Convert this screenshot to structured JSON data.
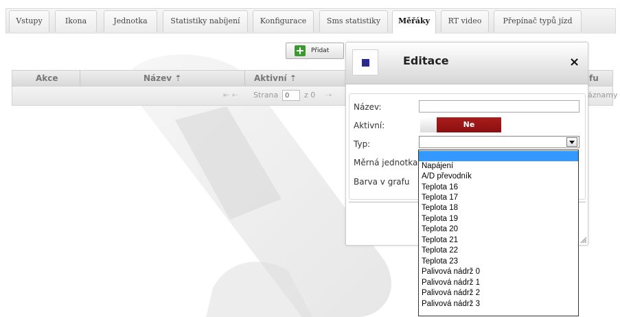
{
  "tabs": [
    "Vstupy",
    "Ikona",
    "Jednotka",
    "Statistiky nabíjení",
    "Konfigurace",
    "Sms statistiky",
    "Měřáky",
    "RT video",
    "Přepínač typů jízd"
  ],
  "active_tab": "Měřáky",
  "toolbar": {
    "add_label": "Přidat"
  },
  "grid": {
    "columns": [
      "Akce",
      "Název ⇡",
      "Aktivní ⇡",
      "fu"
    ],
    "pager": {
      "prefix": "Strana",
      "page": "0",
      "of_label": "z 0",
      "right_text": "áznamy"
    }
  },
  "modal": {
    "title": "Editace",
    "close": "×",
    "labels": {
      "name": "Název:",
      "active": "Aktivní:",
      "type": "Typ:",
      "unit": "Měrná jednotka",
      "graph_color": "Barva v grafu"
    },
    "active_value": "Ne",
    "name_value": "",
    "type_value": ""
  },
  "type_options": [
    "",
    "Napájení",
    "A/D převodník",
    "Teplota 16",
    "Teplota 17",
    "Teplota 18",
    "Teplota 19",
    "Teplota 20",
    "Teplota 21",
    "Teplota 22",
    "Teplota 23",
    "Palivová nádrž 0",
    "Palivová nádrž 1",
    "Palivová nádrž 2",
    "Palivová nádrž 3"
  ],
  "colors": {
    "toggle_off": "#9a1515",
    "modal_icon": "#2a2a8e",
    "selected_option": "#3399ff",
    "add_icon": "#3a9a2e"
  },
  "icons": {
    "add": "plus-icon",
    "close": "close-icon",
    "select_arrow": "chevron-down-icon"
  }
}
